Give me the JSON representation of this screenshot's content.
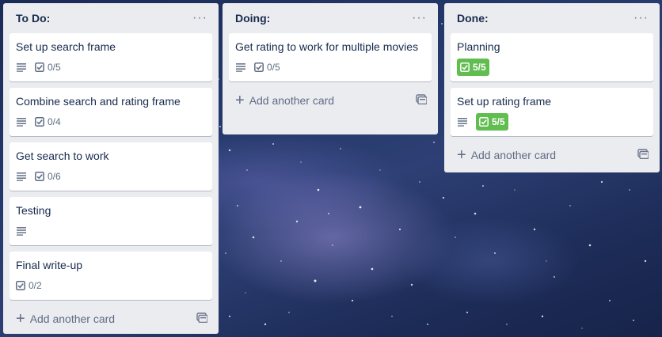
{
  "colors": {
    "complete_badge": "#61bd4f",
    "list_bg": "#ebecf0",
    "text": "#172b4d",
    "muted": "#5e6c84"
  },
  "lists": [
    {
      "title": "To Do:",
      "menu": "···",
      "cards": [
        {
          "title": "Set up search frame",
          "checklist": "0/5"
        },
        {
          "title": "Combine search and rating frame",
          "checklist": "0/4"
        },
        {
          "title": "Get search to work",
          "checklist": "0/6"
        },
        {
          "title": "Testing"
        },
        {
          "title": "Final write-up",
          "checklist": "0/2"
        }
      ],
      "add_label": "Add another card"
    },
    {
      "title": "Doing:",
      "menu": "···",
      "cards": [
        {
          "title": "Get rating to work for multiple movies",
          "checklist": "0/5"
        }
      ],
      "add_label": "Add another card"
    },
    {
      "title": "Done:",
      "menu": "···",
      "cards": [
        {
          "title": "Planning",
          "checklist": "5/5"
        },
        {
          "title": "Set up rating frame",
          "checklist": "5/5"
        }
      ],
      "add_label": "Add another card"
    }
  ]
}
